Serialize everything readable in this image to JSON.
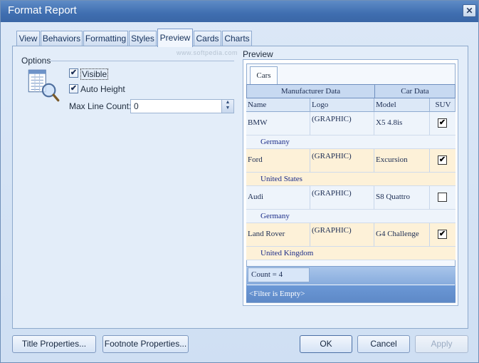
{
  "window": {
    "title": "Format Report",
    "close_glyph": "✕"
  },
  "tabs": [
    "View",
    "Behaviors",
    "Formatting",
    "Styles",
    "Preview",
    "Cards",
    "Charts"
  ],
  "active_tab": "Preview",
  "watermark": "www.softpedia.com",
  "options": {
    "group_label": "Options",
    "visible": {
      "label": "Visible",
      "checked": true
    },
    "auto_height": {
      "label": "Auto Height",
      "checked": true
    },
    "max_line_count": {
      "label": "Max Line Count:",
      "value": "0"
    }
  },
  "preview": {
    "label": "Preview",
    "tab": "Cars",
    "bands": [
      "Manufacturer Data",
      "Car Data"
    ],
    "columns": [
      "Name",
      "Logo",
      "Model",
      "SUV"
    ],
    "rows": [
      {
        "name": "BMW",
        "logo": "(GRAPHIC)",
        "model": "X5 4.8is",
        "suv": true,
        "country": "Germany"
      },
      {
        "name": "Ford",
        "logo": "(GRAPHIC)",
        "model": "Excursion",
        "suv": true,
        "country": "United States"
      },
      {
        "name": "Audi",
        "logo": "(GRAPHIC)",
        "model": "S8 Quattro",
        "suv": false,
        "country": "Germany"
      },
      {
        "name": "Land Rover",
        "logo": "(GRAPHIC)",
        "model": "G4 Challenge",
        "suv": true,
        "country": "United Kingdom"
      }
    ],
    "row_colors": [
      "#eef4fb",
      "#fdf1d8"
    ],
    "footer_count": "Count = 4",
    "filter_text": "<Filter is Empty>"
  },
  "buttons": {
    "title_properties": "Title Properties...",
    "footnote_properties": "Footnote Properties...",
    "ok": "OK",
    "cancel": "Cancel",
    "apply": "Apply"
  },
  "icons": {
    "options_icon": "report-magnifier-icon",
    "check_glyph": "✔"
  }
}
